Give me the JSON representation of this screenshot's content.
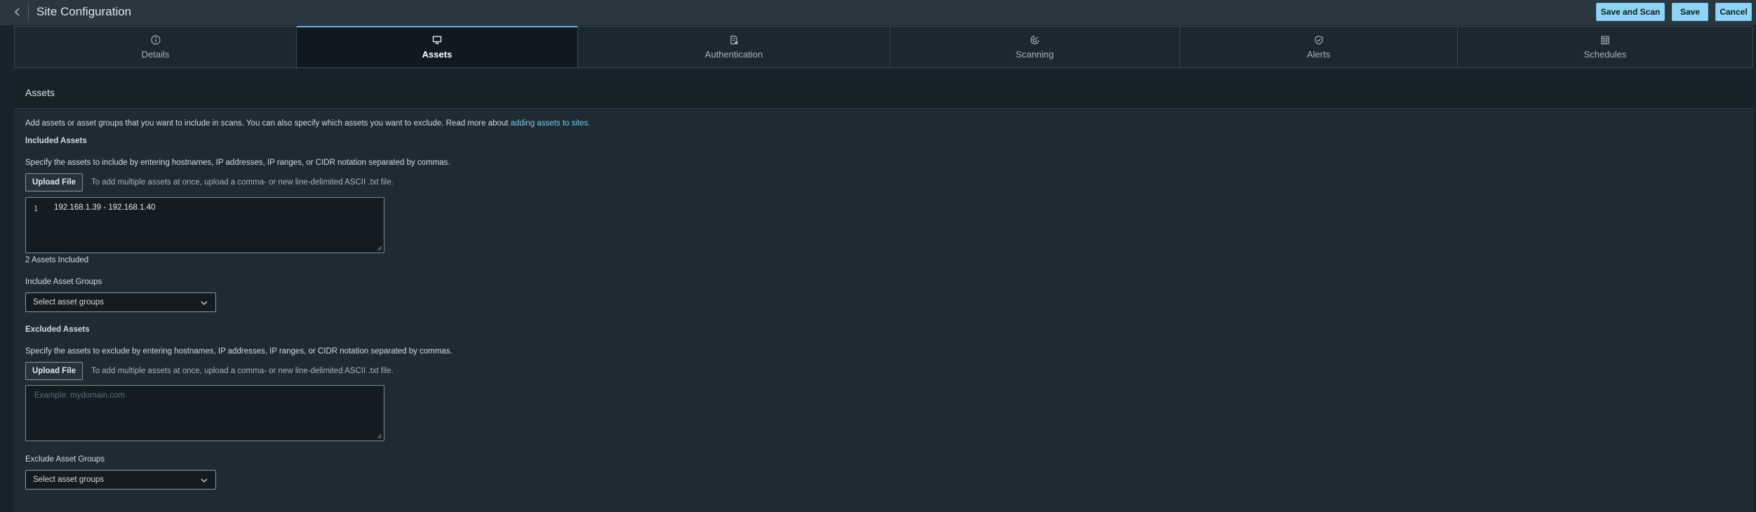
{
  "header": {
    "title": "Site Configuration",
    "save_and_scan_label": "Save and Scan",
    "save_label": "Save",
    "cancel_label": "Cancel"
  },
  "tabs": [
    {
      "label": "Details",
      "icon": "info-icon"
    },
    {
      "label": "Assets",
      "icon": "monitor-icon",
      "active": true
    },
    {
      "label": "Authentication",
      "icon": "document-lock-icon"
    },
    {
      "label": "Scanning",
      "icon": "radar-icon"
    },
    {
      "label": "Alerts",
      "icon": "shield-check-icon"
    },
    {
      "label": "Schedules",
      "icon": "calendar-icon"
    }
  ],
  "panel": {
    "title": "Assets",
    "intro_text": "Add assets or asset groups that you want to include in scans. You can also specify which assets you want to exclude. Read more about",
    "intro_link": "adding assets to sites.",
    "included": {
      "heading": "Included Assets",
      "instructions": "Specify the assets to include by entering hostnames, IP addresses, IP ranges, or CIDR notation separated by commas.",
      "upload_label": "Upload File",
      "upload_hint": "To add multiple assets at once, upload a comma- or new line-delimited ASCII .txt file.",
      "line_number": "1",
      "value": "192.168.1.39 - 192.168.1.40",
      "count_text": "2 Assets Included",
      "groups_label": "Include Asset Groups",
      "groups_placeholder": "Select asset groups"
    },
    "excluded": {
      "heading": "Excluded Assets",
      "instructions": "Specify the assets to exclude by entering hostnames, IP addresses, IP ranges, or CIDR notation separated by commas.",
      "upload_label": "Upload File",
      "upload_hint": "To add multiple assets at once, upload a comma- or new line-delimited ASCII .txt file.",
      "placeholder": "Example: mydomain.com",
      "groups_label": "Exclude Asset Groups",
      "groups_placeholder": "Select asset groups"
    }
  },
  "colors": {
    "accent": "#8fd4f5",
    "link": "#7fc7ec",
    "background": "#18232b"
  }
}
